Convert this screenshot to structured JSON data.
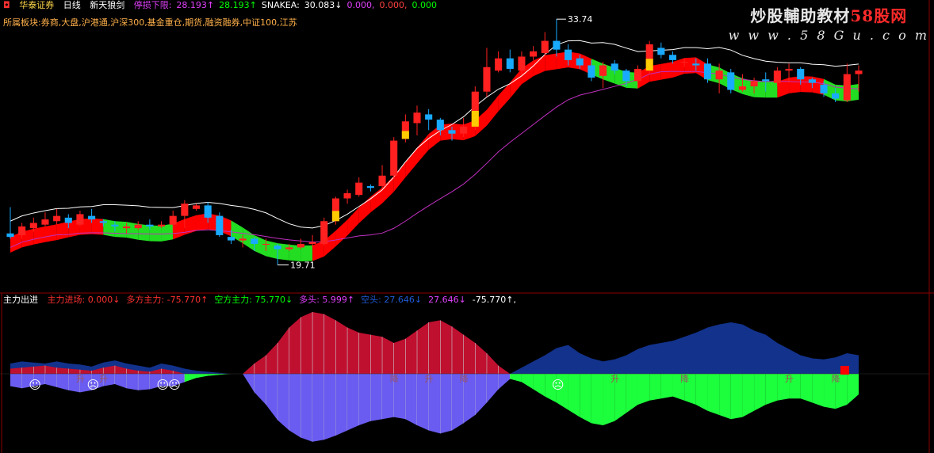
{
  "header": {
    "broker": "华泰证券",
    "period": "日线",
    "formula": "新天狼剑",
    "items": [
      {
        "label": "停损下限:",
        "color": "#e040fb"
      },
      {
        "value": "28.193↑",
        "color": "#e040fb"
      },
      {
        "value": "28.193↑",
        "color": "#00ff00"
      },
      {
        "label": "SNAKEA:",
        "color": "#ffffff"
      },
      {
        "value": "30.083↓",
        "color": "#ffffff"
      },
      {
        "value": "0.000,",
        "color": "#e040fb"
      },
      {
        "value": "0.000,",
        "color": "#ff4040"
      },
      {
        "value": "0.000",
        "color": "#00ff00"
      }
    ]
  },
  "sector_line": "所属板块:券商,大盘,沪港通,沪深300,基金重仓,期货,融资融券,中证100,江苏",
  "price_labels": {
    "high": "33.74",
    "low": "19.71"
  },
  "watermark": {
    "line1_a": "炒股輔助教材",
    "line1_b": "58股网",
    "line2": "w w w . 5 8 G u . c o m"
  },
  "lower_header": {
    "name": "主力出进",
    "items": [
      {
        "text": "主力进场: 0.000↓",
        "color": "#ff3030"
      },
      {
        "text": "多方主力: -75.770↑",
        "color": "#ff3030"
      },
      {
        "text": "空方主力: 75.770↓",
        "color": "#00ff00"
      },
      {
        "text": "多头: 5.999↑",
        "color": "#e040fb"
      },
      {
        "text": "空头: 27.646↓",
        "color": "#1e5bd6"
      },
      {
        "text": "27.646↓",
        "color": "#e040fb"
      },
      {
        "text": "-75.770↑,",
        "color": "#ffffff"
      }
    ]
  },
  "markers": {
    "up": "升",
    "down": "降",
    "smile": "☺",
    "sad": "☹"
  },
  "colors": {
    "up": "#ff2020",
    "down": "#18aaff",
    "ma": "#ffffff",
    "slow": "#c030c0",
    "bullBand": "#ff0000",
    "bearBand": "#22dd22",
    "grid": "#8b0000"
  },
  "chart_data": {
    "type": "candlestick",
    "ohlc": [
      [
        21.5,
        21.3,
        23.0,
        21.2
      ],
      [
        21.4,
        21.9,
        22.1,
        21.2
      ],
      [
        21.8,
        22.1,
        22.4,
        21.6
      ],
      [
        22.0,
        22.3,
        22.7,
        21.9
      ],
      [
        22.2,
        22.5,
        22.9,
        22.0
      ],
      [
        22.4,
        22.1,
        22.6,
        21.8
      ],
      [
        22.0,
        22.6,
        22.8,
        21.9
      ],
      [
        22.5,
        22.3,
        22.9,
        22.1
      ],
      [
        22.2,
        22.1,
        22.3,
        21.9
      ],
      [
        22.0,
        21.9,
        22.2,
        21.6
      ],
      [
        21.8,
        21.9,
        22.1,
        21.5
      ],
      [
        21.8,
        22.0,
        22.2,
        21.7
      ],
      [
        22.0,
        21.9,
        22.3,
        21.7
      ],
      [
        21.9,
        22.0,
        22.2,
        21.8
      ],
      [
        22.0,
        22.5,
        22.8,
        21.6
      ],
      [
        22.5,
        23.2,
        23.4,
        21.8
      ],
      [
        22.9,
        23.1,
        23.2,
        22.8
      ],
      [
        23.1,
        22.4,
        23.3,
        22.1
      ],
      [
        22.5,
        21.4,
        22.7,
        21.3
      ],
      [
        21.3,
        21.1,
        21.7,
        20.9
      ],
      [
        21.1,
        21.2,
        21.4,
        20.7
      ],
      [
        21.2,
        20.9,
        21.3,
        20.5
      ],
      [
        20.9,
        20.9,
        21.2,
        20.5
      ],
      [
        20.8,
        20.6,
        20.9,
        19.7
      ],
      [
        20.6,
        20.7,
        20.9,
        20.5
      ],
      [
        20.7,
        20.9,
        21.2,
        20.6
      ],
      [
        20.9,
        21.0,
        21.4,
        20.7
      ],
      [
        20.9,
        22.2,
        22.4,
        20.8
      ],
      [
        22.2,
        23.5,
        23.6,
        22.0
      ],
      [
        23.5,
        23.8,
        24.0,
        23.2
      ],
      [
        23.7,
        24.4,
        24.7,
        23.6
      ],
      [
        24.2,
        24.1,
        24.3,
        23.9
      ],
      [
        24.2,
        24.8,
        25.4,
        24.1
      ],
      [
        24.8,
        26.8,
        27.0,
        24.6
      ],
      [
        26.9,
        27.9,
        28.3,
        26.7
      ],
      [
        27.8,
        28.4,
        28.8,
        27.1
      ],
      [
        28.3,
        28.0,
        28.6,
        27.4
      ],
      [
        28.0,
        27.4,
        28.1,
        27.1
      ],
      [
        27.4,
        27.2,
        27.6,
        26.8
      ],
      [
        27.2,
        27.6,
        28.1,
        27.0
      ],
      [
        27.6,
        29.6,
        29.9,
        27.4
      ],
      [
        29.6,
        31.0,
        32.1,
        29.3
      ],
      [
        30.8,
        31.5,
        31.9,
        30.7
      ],
      [
        31.5,
        30.9,
        32.0,
        30.7
      ],
      [
        30.8,
        31.6,
        31.9,
        30.6
      ],
      [
        31.6,
        31.9,
        32.2,
        31.4
      ],
      [
        31.8,
        32.5,
        33.0,
        31.6
      ],
      [
        32.5,
        32.0,
        33.74,
        31.6
      ],
      [
        32.0,
        31.4,
        32.3,
        31.1
      ],
      [
        31.5,
        31.1,
        31.7,
        30.9
      ],
      [
        31.1,
        30.4,
        31.4,
        30.2
      ],
      [
        30.5,
        31.1,
        31.3,
        29.8
      ],
      [
        31.2,
        30.8,
        31.4,
        30.6
      ],
      [
        30.8,
        30.2,
        30.9,
        29.9
      ],
      [
        30.2,
        30.9,
        31.1,
        29.8
      ],
      [
        30.8,
        32.3,
        32.5,
        30.6
      ],
      [
        32.1,
        31.7,
        32.4,
        31.5
      ],
      [
        31.7,
        31.4,
        31.9,
        31.2
      ],
      [
        31.3,
        31.3,
        31.5,
        31.0
      ],
      [
        31.2,
        31.1,
        31.5,
        30.8
      ],
      [
        31.2,
        30.3,
        31.5,
        30.1
      ],
      [
        30.3,
        30.8,
        31.2,
        29.5
      ],
      [
        30.7,
        29.7,
        30.9,
        29.5
      ],
      [
        29.7,
        29.9,
        30.6,
        29.6
      ],
      [
        29.9,
        30.2,
        30.4,
        29.5
      ],
      [
        30.3,
        30.2,
        30.7,
        29.6
      ],
      [
        30.1,
        30.8,
        31.0,
        29.9
      ],
      [
        30.8,
        30.9,
        31.2,
        30.1
      ],
      [
        30.9,
        30.3,
        31.0,
        30.0
      ],
      [
        30.3,
        30.1,
        30.4,
        29.8
      ],
      [
        30.0,
        29.5,
        30.2,
        29.3
      ],
      [
        29.5,
        29.2,
        29.8,
        29.0
      ],
      [
        29.1,
        30.6,
        31.2,
        29.0
      ],
      [
        30.6,
        30.8,
        31.1,
        29.6
      ]
    ],
    "osc_bull": [
      5,
      6,
      7,
      8,
      6,
      5,
      4,
      3,
      6,
      8,
      5,
      3,
      2,
      5,
      3,
      0,
      0,
      0,
      0,
      0,
      0,
      10,
      18,
      30,
      45,
      55,
      60,
      58,
      52,
      45,
      40,
      38,
      36,
      30,
      34,
      42,
      50,
      52,
      46,
      38,
      30,
      20,
      8,
      0,
      0,
      0,
      0,
      0,
      0,
      0,
      0,
      0,
      0,
      0,
      0,
      0,
      0,
      0,
      0,
      0,
      0,
      0,
      0,
      0,
      0,
      0,
      0,
      0,
      0,
      0,
      0,
      0,
      0,
      0
    ],
    "osc_bear": [
      10,
      12,
      11,
      10,
      12,
      10,
      9,
      7,
      11,
      13,
      10,
      8,
      6,
      10,
      8,
      5,
      3,
      2,
      1,
      0,
      0,
      2,
      3,
      4,
      5,
      6,
      6,
      6,
      5,
      4,
      5,
      6,
      7,
      5,
      4,
      4,
      5,
      6,
      5,
      4,
      3,
      2,
      1,
      0,
      6,
      12,
      18,
      25,
      28,
      20,
      15,
      12,
      14,
      18,
      24,
      28,
      30,
      32,
      36,
      40,
      45,
      48,
      50,
      48,
      42,
      38,
      30,
      24,
      18,
      15,
      14,
      16,
      20,
      18
    ],
    "osc_neg": [
      -12,
      -14,
      -12,
      -10,
      -13,
      -16,
      -18,
      -16,
      -12,
      -10,
      -14,
      -16,
      -15,
      -12,
      -12,
      -8,
      -4,
      -2,
      -1,
      0,
      0,
      -18,
      -30,
      -45,
      -55,
      -62,
      -66,
      -64,
      -60,
      -55,
      -50,
      -46,
      -44,
      -42,
      -44,
      -50,
      -55,
      -58,
      -55,
      -48,
      -40,
      -28,
      -15,
      -5,
      -8,
      -15,
      -22,
      -28,
      -35,
      -42,
      -48,
      -50,
      -46,
      -38,
      -30,
      -26,
      -24,
      -22,
      -26,
      -30,
      -36,
      -40,
      -44,
      -42,
      -36,
      -30,
      -26,
      -24,
      -24,
      -28,
      -32,
      -34,
      -30,
      -20
    ]
  }
}
